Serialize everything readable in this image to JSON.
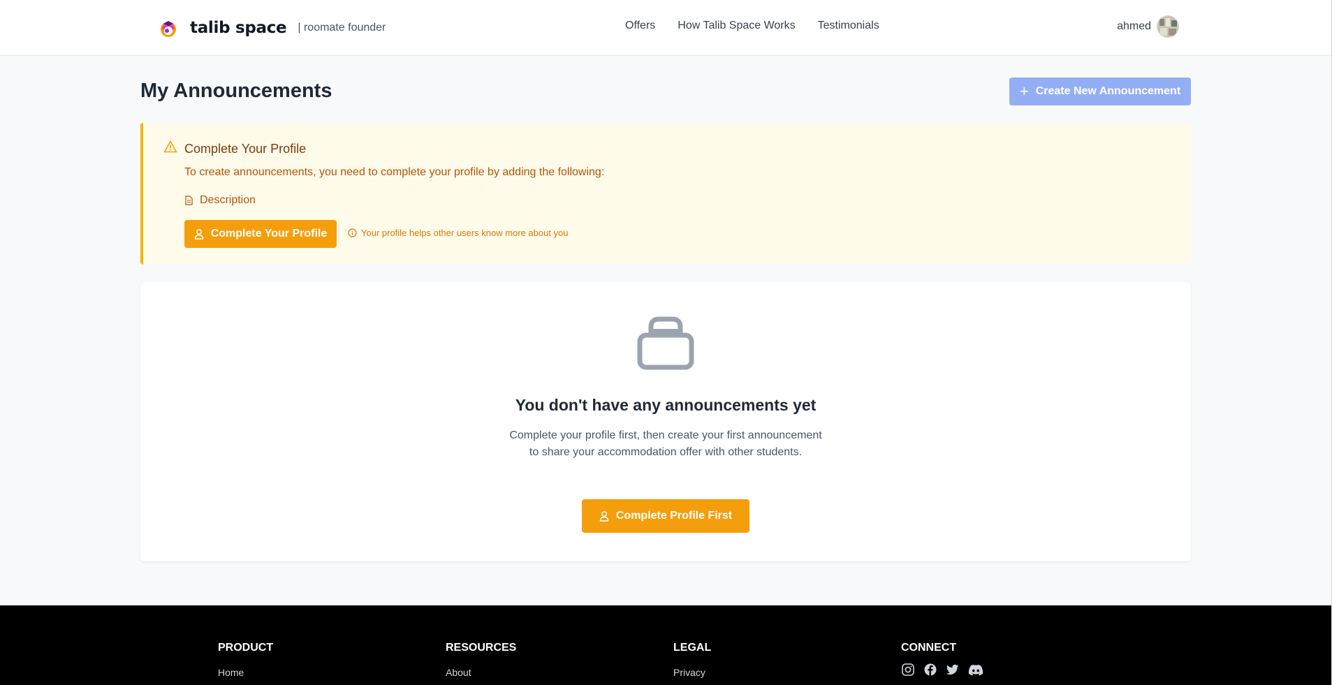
{
  "header": {
    "brand": "talib space",
    "brand_sub": "| roomate founder",
    "nav": [
      "Offers",
      "How Talib Space Works",
      "Testimonials"
    ],
    "user_name": "ahmed"
  },
  "main": {
    "title": "My Announcements",
    "create_button": "Create New Announcement",
    "alert": {
      "title": "Complete Your Profile",
      "text": "To create announcements, you need to complete your profile by adding the following:",
      "requirements": [
        "Description"
      ],
      "button": "Complete Your Profile",
      "hint": "Your profile helps other users know more about you"
    },
    "empty": {
      "title": "You don't have any announcements yet",
      "text": "Complete your profile first, then create your first announcement to share your accommodation offer with other students.",
      "button": "Complete Profile First"
    }
  },
  "footer": {
    "columns": [
      {
        "heading": "PRODUCT",
        "link": "Home"
      },
      {
        "heading": "RESOURCES",
        "link": "About"
      },
      {
        "heading": "LEGAL",
        "link": "Privacy"
      },
      {
        "heading": "CONNECT"
      }
    ],
    "social_icons": [
      "instagram-icon",
      "facebook-icon",
      "twitter-icon",
      "discord-icon"
    ]
  },
  "colors": {
    "accent": "#f59e0b",
    "primary_disabled": "#93aef4",
    "alert_bg": "#fefbea",
    "alert_border": "#f7b40d",
    "footer_bg": "#000000"
  }
}
